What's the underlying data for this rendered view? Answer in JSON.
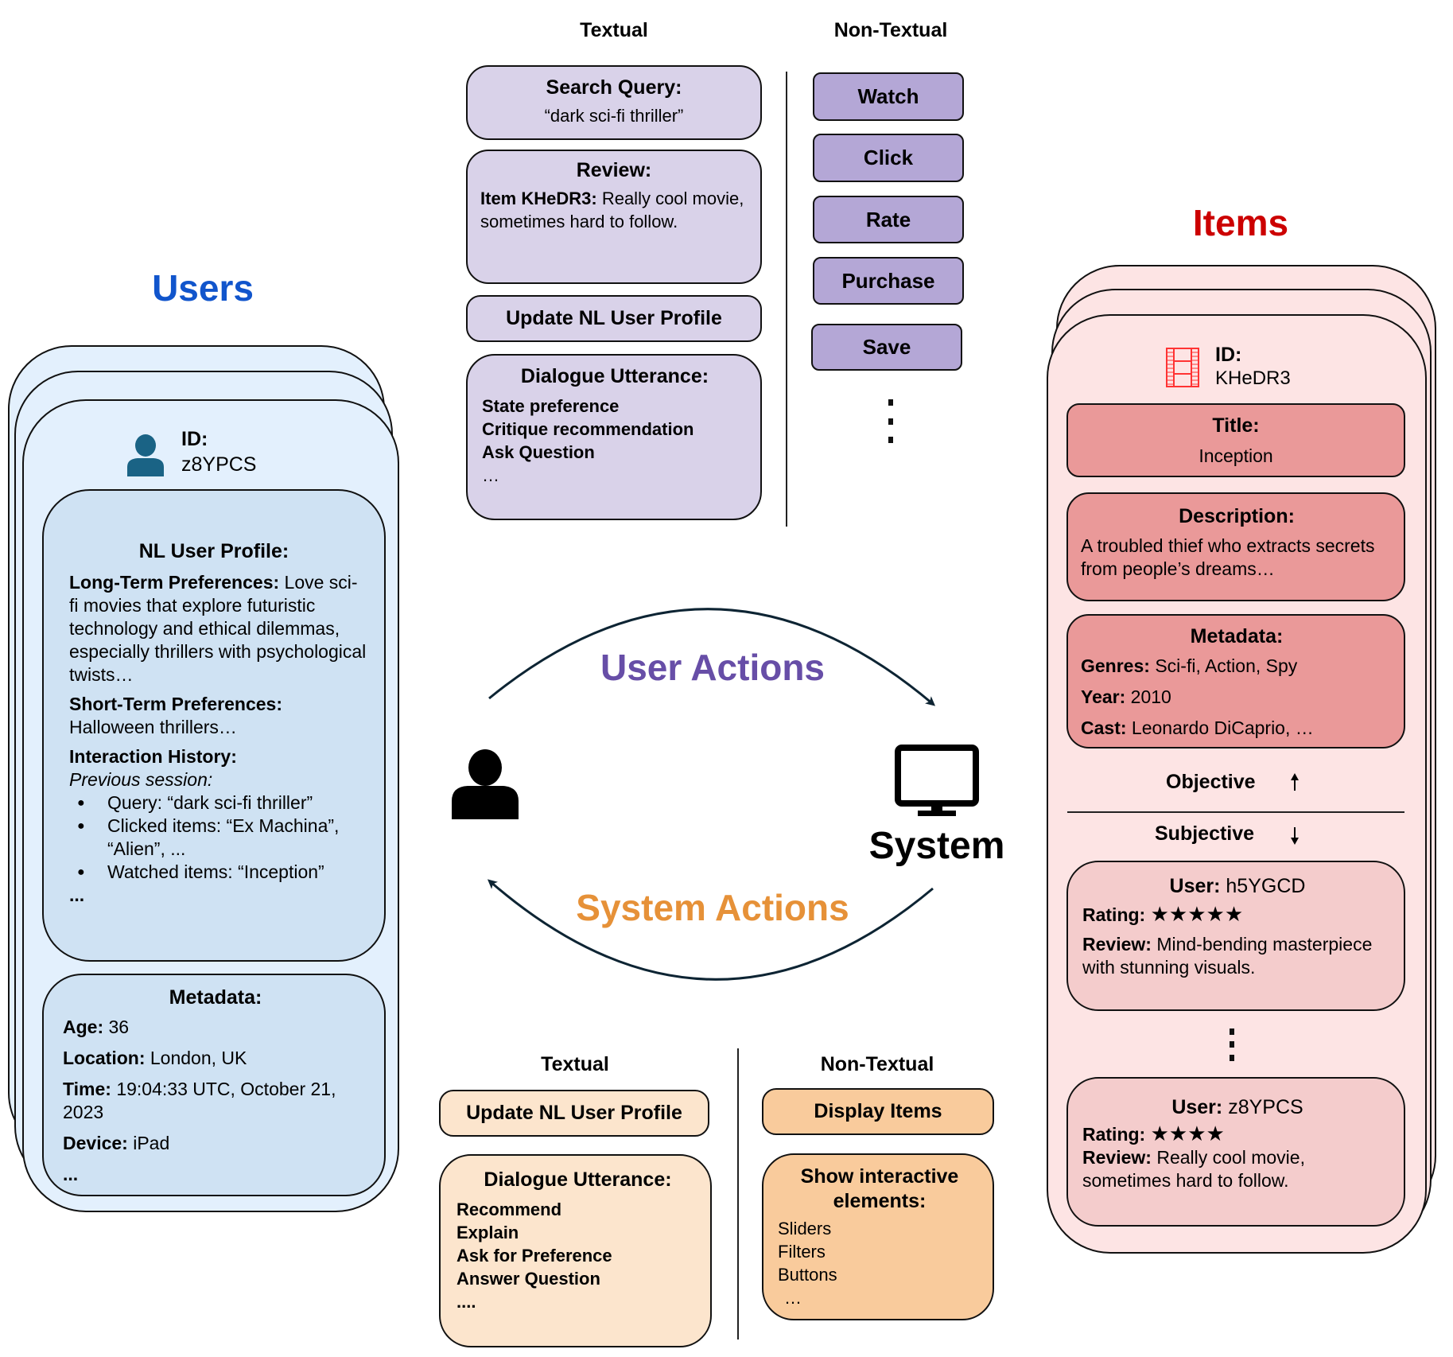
{
  "users": {
    "title": "Users",
    "title_color": "#1155cc",
    "id_label": "ID:",
    "id_value": "z8YPCS",
    "icon": "user-icon",
    "profile": {
      "heading": "NL User Profile:",
      "long_term_label": "Long-Term Preferences:",
      "long_term_text": "Love sci-fi movies that explore futuristic technology and ethical dilemmas, especially thrillers with psychological twists…",
      "short_term_label": "Short-Term Preferences:",
      "short_term_text": "Halloween thrillers…",
      "history_label": "Interaction History:",
      "history_session": "Previous session:",
      "history_items": [
        "Query: “dark sci-fi thriller”",
        "Clicked items: “Ex Machina”, “Alien”, ...",
        "Watched items: “Inception”"
      ],
      "more": "..."
    },
    "metadata": {
      "heading": "Metadata:",
      "fields": [
        {
          "label": "Age:",
          "value": "36"
        },
        {
          "label": "Location:",
          "value": "London, UK"
        },
        {
          "label": "Time:",
          "value": "19:04:33 UTC, October 21, 2023"
        },
        {
          "label": "Device:",
          "value": "iPad"
        }
      ],
      "more": "..."
    }
  },
  "user_actions": {
    "title": "User Actions",
    "title_color": "#674ea7",
    "textual_header": "Textual",
    "non_textual_header": "Non-Textual",
    "search": {
      "heading": "Search Query:",
      "value": "“dark sci-fi thriller”"
    },
    "review": {
      "heading": "Review:",
      "item_label": "Item KHeDR3:",
      "text": "Really cool movie, sometimes hard to follow."
    },
    "update_profile": "Update NL User Profile",
    "dialogue": {
      "heading": "Dialogue Utterance:",
      "items": [
        "State preference",
        "Critique recommendation",
        "Ask Question",
        "…"
      ]
    },
    "buttons": [
      "Watch",
      "Click",
      "Rate",
      "Purchase",
      "Save"
    ]
  },
  "system_actions": {
    "title": "System Actions",
    "title_color": "#e69138",
    "textual_header": "Textual",
    "non_textual_header": "Non-Textual",
    "update_profile": "Update NL User Profile",
    "dialogue": {
      "heading": "Dialogue Utterance:",
      "items": [
        "Recommend",
        "Explain",
        "Ask for Preference",
        "Answer Question",
        "...."
      ]
    },
    "display_items": "Display Items",
    "interactive": {
      "heading": "Show interactive elements:",
      "items": [
        "Sliders",
        "Filters",
        "Buttons",
        "…"
      ]
    }
  },
  "center": {
    "system_label": "System",
    "user_icon": "person-icon",
    "system_icon": "monitor-icon"
  },
  "items": {
    "title": "Items",
    "title_color": "#cc0000",
    "icon": "film-icon",
    "id_label": "ID:",
    "id_value": "KHeDR3",
    "title_box": {
      "heading": "Title:",
      "value": "Inception"
    },
    "description": {
      "heading": "Description:",
      "value": "A troubled thief who extracts secrets from people’s dreams…"
    },
    "metadata": {
      "heading": "Metadata:",
      "fields": [
        {
          "label": "Genres:",
          "value": "Sci-fi, Action, Spy"
        },
        {
          "label": "Year:",
          "value": "2010"
        },
        {
          "label": "Cast:",
          "value": "Leonardo DiCaprio, …"
        }
      ]
    },
    "objective_label": "Objective",
    "subjective_label": "Subjective",
    "reviews": [
      {
        "user_label": "User:",
        "user": "h5YGCD",
        "rating_label": "Rating:",
        "rating": 5,
        "rating_stars": "★★★★★",
        "review_label": "Review:",
        "review": "Mind-bending masterpiece with stunning visuals."
      },
      {
        "user_label": "User:",
        "user": "z8YPCS",
        "rating_label": "Rating:",
        "rating": 4,
        "rating_stars": "★★★★",
        "review_label": "Review:",
        "review": "Really cool movie, sometimes hard to follow."
      }
    ]
  }
}
